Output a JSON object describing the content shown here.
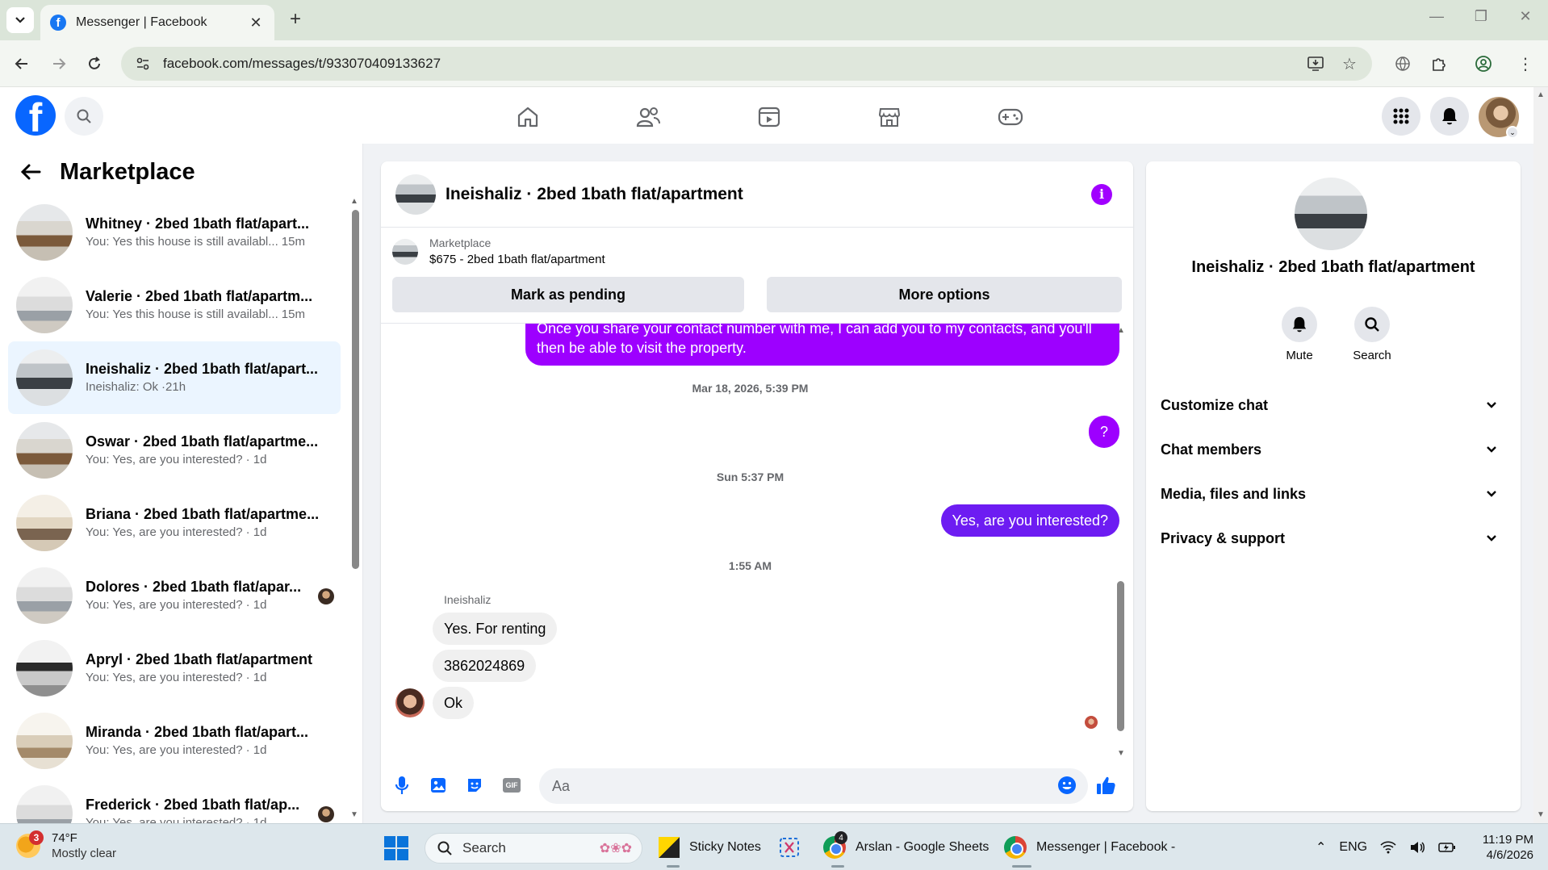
{
  "browser": {
    "tab_title": "Messenger | Facebook",
    "url": "facebook.com/messages/t/933070409133627",
    "new_tab_label": "+",
    "tab_close_label": "✕"
  },
  "left_panel": {
    "title": "Marketplace",
    "conversations": [
      {
        "name": "Whitney · 2bed 1bath flat/apart...",
        "snippet": "You: Yes this house is still availabl...",
        "time": "15m"
      },
      {
        "name": "Valerie · 2bed 1bath flat/apartm...",
        "snippet": "You: Yes this house is still availabl...",
        "time": "15m"
      },
      {
        "name": "Ineishaliz · 2bed 1bath flat/apart...",
        "snippet": "Ineishaliz: Ok",
        "time": "·21h"
      },
      {
        "name": "Oswar · 2bed 1bath flat/apartme...",
        "snippet": "You: Yes, are you interested?",
        "time": "· 1d"
      },
      {
        "name": "Briana · 2bed 1bath flat/apartme...",
        "snippet": "You: Yes, are you interested?",
        "time": "· 1d"
      },
      {
        "name": "Dolores · 2bed 1bath flat/apar...",
        "snippet": "You: Yes, are you interested?",
        "time": "· 1d"
      },
      {
        "name": "Apryl · 2bed 1bath flat/apartment",
        "snippet": "You: Yes, are you interested?",
        "time": "· 1d"
      },
      {
        "name": "Miranda · 2bed 1bath flat/apart...",
        "snippet": "You: Yes, are you interested?",
        "time": "· 1d"
      },
      {
        "name": "Frederick · 2bed 1bath flat/ap...",
        "snippet": "You: Yes, are you interested?",
        "time": "· 1d"
      }
    ]
  },
  "chat": {
    "title": "Ineishaliz · 2bed 1bath flat/apartment",
    "listing_source": "Marketplace",
    "listing_price": "$675 - 2bed 1bath flat/apartment",
    "mark_pending_label": "Mark as pending",
    "more_options_label": "More options",
    "messages": {
      "outgoing_contact": "Once you share your contact number with me, I can add you to my contacts, and you'll then be able to visit the property.",
      "timestamp_1": "Mar 18, 2026, 5:39 PM",
      "outgoing_question": "?",
      "timestamp_2": "Sun 5:37 PM",
      "outgoing_interested": "Yes, are you interested?",
      "timestamp_3": "1:55 AM",
      "sender_name": "Ineishaliz",
      "incoming_1": "Yes. For renting",
      "incoming_2": "3862024869",
      "incoming_3": "Ok"
    },
    "composer_placeholder": "Aa",
    "gif_label": "GIF"
  },
  "info_panel": {
    "title": "Ineishaliz · 2bed 1bath flat/apartment",
    "mute_label": "Mute",
    "search_label": "Search",
    "sections": [
      "Customize chat",
      "Chat members",
      "Media, files and links",
      "Privacy & support"
    ]
  },
  "taskbar": {
    "weather_temp": "74°F",
    "weather_desc": "Mostly clear",
    "weather_badge": "3",
    "search_label": "Search",
    "apps": [
      {
        "label": "Sticky Notes"
      },
      {
        "label": "Arslan - Google Sheets"
      },
      {
        "label": "Messenger | Facebook -"
      }
    ],
    "chrome_badge": "4",
    "language": "ENG",
    "time": "11:19 PM",
    "date": "4/6/2026"
  },
  "colors": {
    "facebook_blue": "#0866ff",
    "outgoing_bubble": "#9d00ff",
    "outgoing_bubble_blue": "#6d1cf2",
    "info_icon": "#a100ff",
    "active_conversation": "#ebf5ff"
  }
}
